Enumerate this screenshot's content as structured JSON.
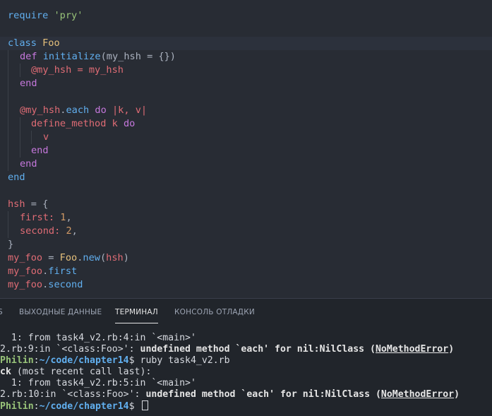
{
  "code": {
    "l1": [
      "require ",
      "'pry'"
    ],
    "l3": [
      "class",
      " ",
      "Foo"
    ],
    "l4": [
      "def",
      " ",
      "initialize",
      "(my_hsh = {})"
    ],
    "l5": [
      "@my_hsh",
      " = ",
      "my_hsh"
    ],
    "l6": [
      "end"
    ],
    "l8": [
      "@my_hsh",
      ".",
      "each",
      " ",
      "do",
      " |k, v|"
    ],
    "l9": [
      "define_method",
      " k ",
      "do"
    ],
    "l10": [
      "v"
    ],
    "l11": [
      "end"
    ],
    "l12": [
      "end"
    ],
    "l13": [
      "end"
    ],
    "l15": [
      "hsh",
      " = {"
    ],
    "l16": [
      "first:",
      " ",
      "1",
      ","
    ],
    "l17": [
      "second:",
      " ",
      "2",
      ","
    ],
    "l18": [
      "}"
    ],
    "l19": [
      "my_foo",
      " = ",
      "Foo",
      ".",
      "new",
      "(",
      "hsh",
      ")"
    ],
    "l20": [
      "my_foo",
      ".",
      "first"
    ],
    "l21": [
      "my_foo",
      ".",
      "second"
    ]
  },
  "panel": {
    "tabs": {
      "partial": "S",
      "output": "ВЫХОДНЫЕ ДАННЫЕ",
      "terminal": "ТЕРМИНАЛ",
      "debug_console": "КОНСОЛЬ ОТЛАДКИ"
    }
  },
  "terminal": {
    "t1": "  1: from task4_v2.rb:4:in `<main>'",
    "t2": [
      "2.rb:9:in `<class:Foo>': ",
      "undefined method `each' for nil:NilClass (",
      "NoMethodError",
      ")"
    ],
    "t3": [
      "Philin",
      ":",
      "~/code/chapter14",
      "$ ruby task4_v2.rb"
    ],
    "t4": [
      "ck",
      " (most recent call last):"
    ],
    "t5": "  1: from task4_v2.rb:5:in `<main>'",
    "t6": [
      "2.rb:10:in `<class:Foo>': ",
      "undefined method `each' for nil:NilClass (",
      "NoMethodError",
      ")"
    ],
    "t7": [
      "Philin",
      ":",
      "~/code/chapter14",
      "$ "
    ]
  },
  "colors": {
    "editor_bg": "#282c34",
    "panel_bg": "#21252b",
    "keyword": "#c678dd",
    "function": "#61afef",
    "class": "#e5c07b",
    "variable": "#e06c75",
    "string": "#98c379",
    "number": "#d19a66",
    "prompt_user": "#98c379",
    "prompt_path": "#61afef"
  }
}
